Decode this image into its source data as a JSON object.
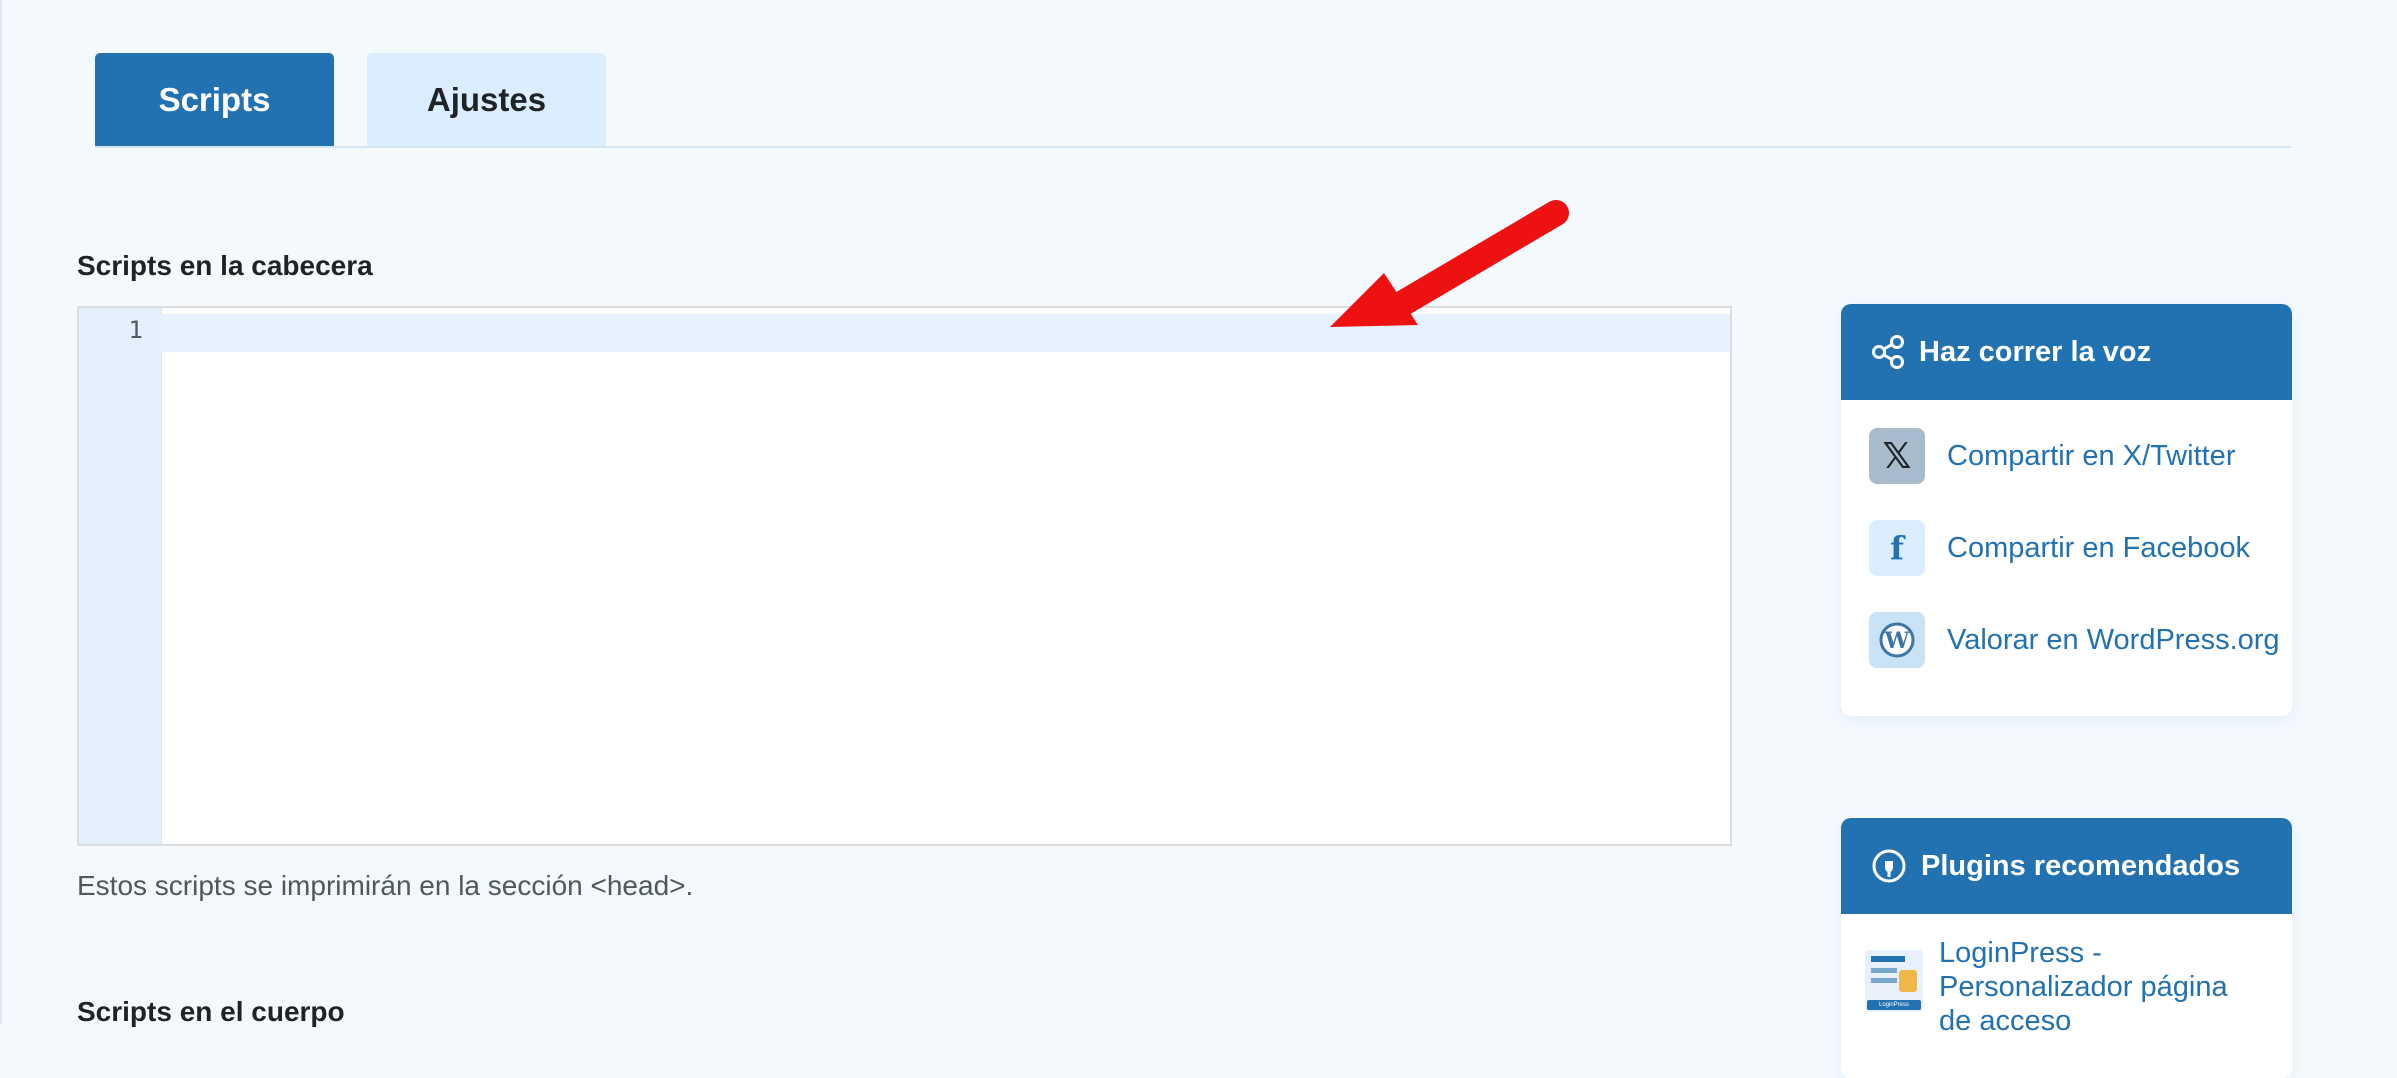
{
  "tabs": [
    {
      "label": "Scripts",
      "active": true
    },
    {
      "label": "Ajustes",
      "active": false
    }
  ],
  "head_section": {
    "label": "Scripts en la cabecera",
    "line_number": "1",
    "code": "",
    "help": "Estos scripts se imprimirán en la sección <head>."
  },
  "body_section": {
    "label": "Scripts en el cuerpo"
  },
  "share_widget": {
    "title": "Haz correr la voz",
    "icon": "share-icon",
    "items": [
      {
        "label": "Compartir en X/Twitter",
        "icon": "x-twitter-icon"
      },
      {
        "label": "Compartir en Facebook",
        "icon": "facebook-icon"
      },
      {
        "label": "Valorar en WordPress.org",
        "icon": "wordpress-icon"
      }
    ]
  },
  "plugins_widget": {
    "title": "Plugins recomendados",
    "icon": "plug-icon",
    "items": [
      {
        "label": "LoginPress - Personalizador página de acceso",
        "thumb_text": "LoginPress"
      }
    ]
  },
  "colors": {
    "accent": "#2271b1",
    "tab_inactive": "#dbeeff",
    "background": "#f4f9fe",
    "annotation_arrow": "#ee1111"
  }
}
